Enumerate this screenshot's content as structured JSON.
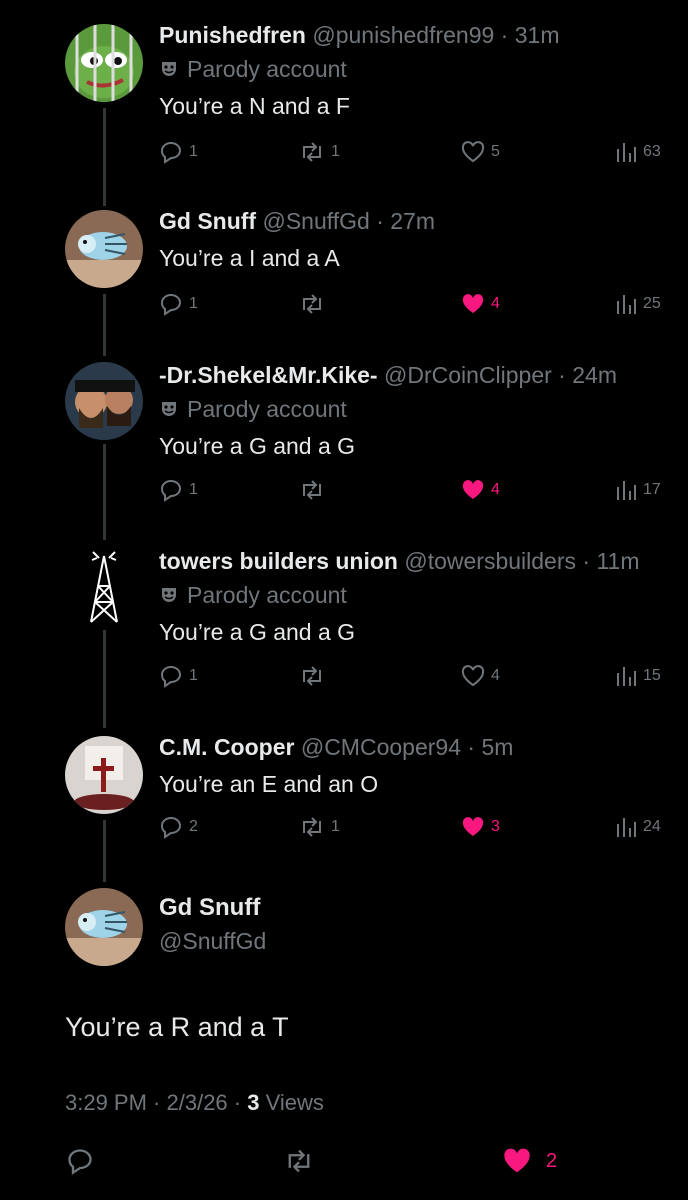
{
  "tweets": [
    {
      "name": "Punishedfren",
      "handle": "@punishedfren99",
      "time": "31m",
      "parody": "Parody account",
      "text": "You’re a N and a F",
      "replies": "1",
      "reposts": "1",
      "likes": "5",
      "views": "63"
    },
    {
      "name": "Gd Snuff",
      "handle": "@SnuffGd",
      "time": "27m",
      "text": "You’re a I and a A",
      "replies": "1",
      "reposts": "",
      "likes": "4",
      "views": "25"
    },
    {
      "name": "-Dr.Shekel&Mr.Kike-",
      "handle": "@DrCoinClipper",
      "time": "24m",
      "parody": "Parody account",
      "text": "You’re a G and a G",
      "replies": "1",
      "reposts": "",
      "likes": "4",
      "views": "17"
    },
    {
      "name": "towers builders union",
      "handle": "@towersbuilders",
      "time": "11m",
      "parody": "Parody account",
      "text": "You’re a G and a G",
      "replies": "1",
      "reposts": "",
      "likes": "4",
      "views": "15"
    },
    {
      "name": "C.M. Cooper",
      "handle": "@CMCooper94",
      "time": "5m",
      "text": "You’re an E and an O",
      "replies": "2",
      "reposts": "1",
      "likes": "3",
      "views": "24"
    }
  ],
  "main": {
    "name": "Gd Snuff",
    "handle": "@SnuffGd",
    "text": "You’re a R and a T",
    "time": "3:29 PM",
    "date": "2/3/26",
    "views_count": "3",
    "views_label": "Views",
    "likes": "2"
  },
  "colors": {
    "like": "#f91880",
    "muted": "#71767b",
    "text": "#e7e9ea",
    "line": "#333639",
    "background": "#000000"
  },
  "icons": [
    "parody-mask-icon",
    "reply-icon",
    "repost-icon",
    "like-icon",
    "views-icon"
  ]
}
